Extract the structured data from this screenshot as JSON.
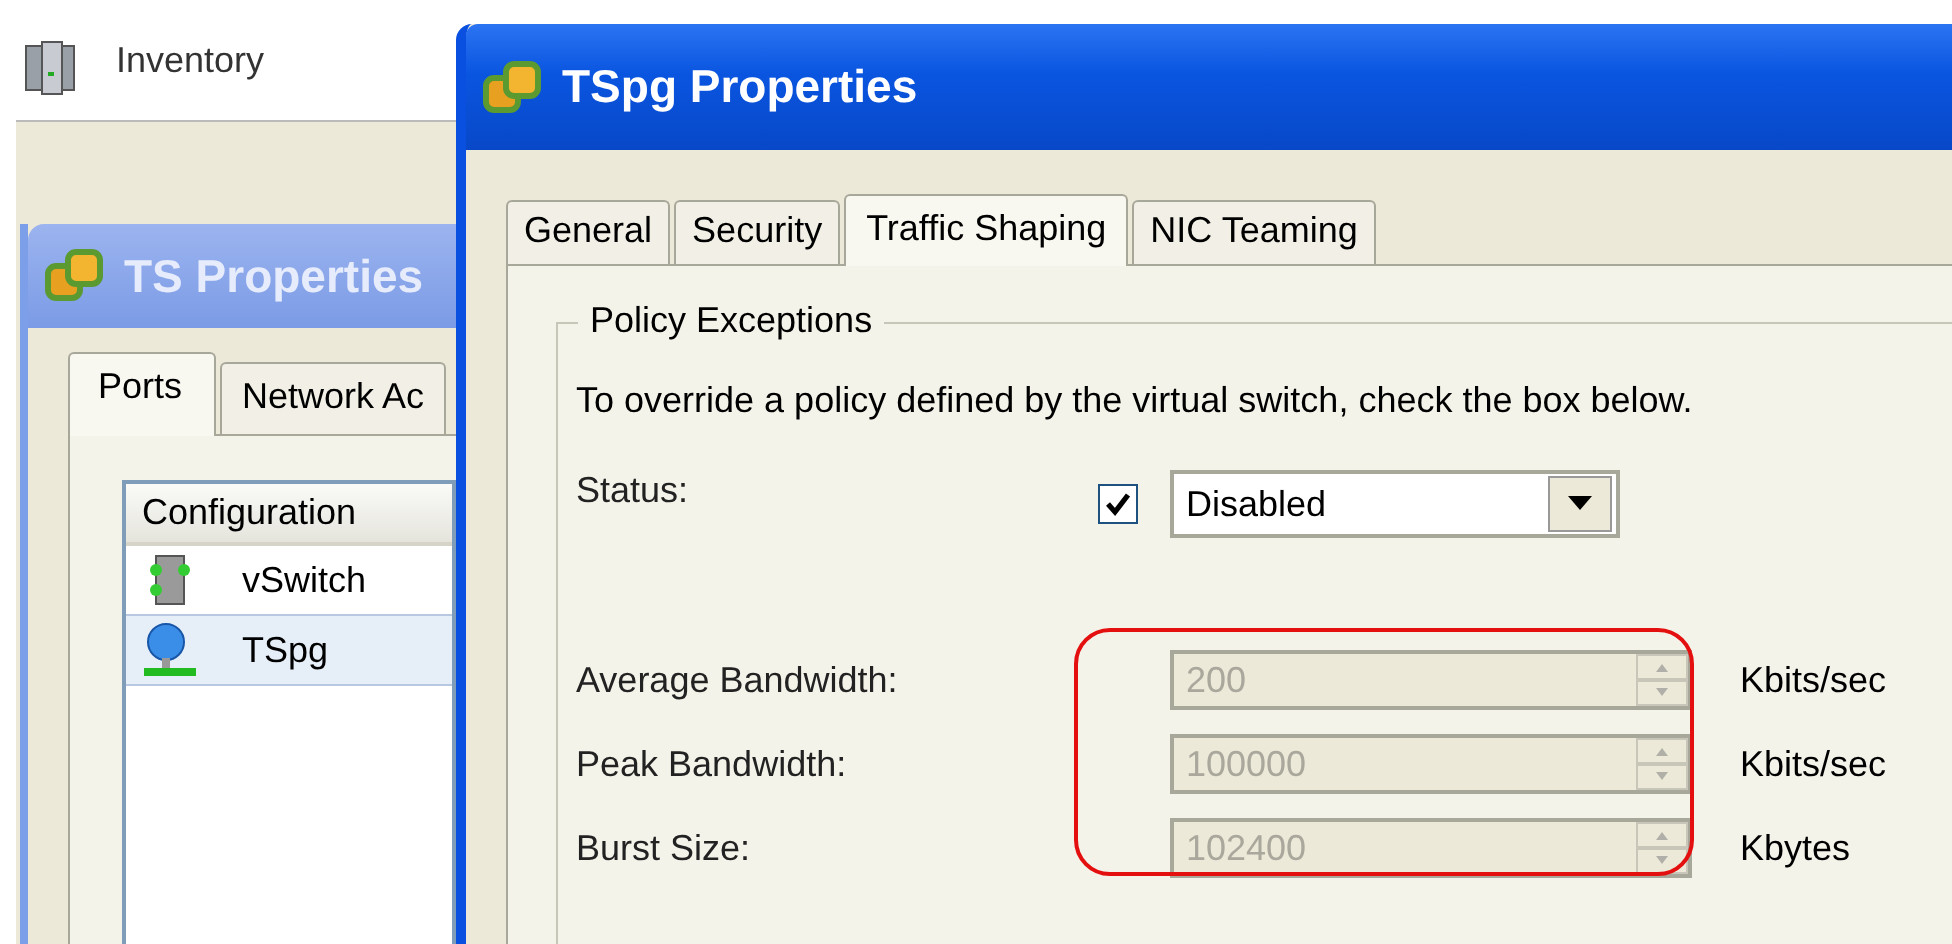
{
  "inventory": {
    "label": "Inventory"
  },
  "back_window": {
    "title": "TS Properties",
    "active": false,
    "tabs": [
      {
        "label": "Ports",
        "selected": true
      },
      {
        "label": "Network Ac",
        "selected": false
      }
    ],
    "list": {
      "header": "Configuration",
      "items": [
        {
          "label": "vSwitch",
          "kind": "switch",
          "selected": false
        },
        {
          "label": "TSpg",
          "kind": "portgroup",
          "selected": true
        }
      ]
    }
  },
  "window": {
    "title": "TSpg Properties",
    "active": true,
    "tabs": [
      {
        "label": "General",
        "selected": false
      },
      {
        "label": "Security",
        "selected": false
      },
      {
        "label": "Traffic Shaping",
        "selected": true
      },
      {
        "label": "NIC Teaming",
        "selected": false
      }
    ],
    "group": {
      "title": "Policy Exceptions",
      "description": "To override a policy defined by the virtual switch, check the box below.",
      "status": {
        "label": "Status:",
        "checked": true,
        "value": "Disabled"
      },
      "fields": [
        {
          "label": "Average Bandwidth:",
          "value": "200",
          "unit": "Kbits/sec",
          "disabled": true
        },
        {
          "label": "Peak Bandwidth:",
          "value": "100000",
          "unit": "Kbits/sec",
          "disabled": true
        },
        {
          "label": "Burst Size:",
          "value": "102400",
          "unit": "Kbytes",
          "disabled": true
        }
      ],
      "highlighted": true
    }
  }
}
